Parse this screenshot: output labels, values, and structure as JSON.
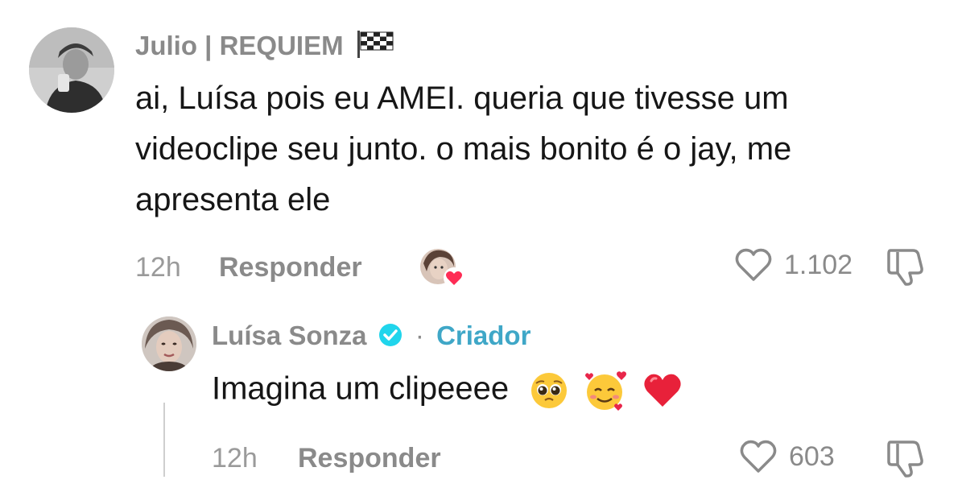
{
  "comments": [
    {
      "username": "Julio | REQUIEM",
      "username_suffix_icon": "checkered-flag-icon",
      "text_lines": [
        "ai, Luísa pois eu AMEI. queria que tivesse um",
        "videoclipe seu junto. o mais bonito é o jay, me",
        "apresenta ele"
      ],
      "time": "12h",
      "reply_label": "Responder",
      "liked_by_creator": true,
      "likes": "1.102"
    }
  ],
  "reply": {
    "username": "Luísa Sonza",
    "verified": true,
    "separator": "·",
    "badge": "Criador",
    "text": "Imagina um clipeeee",
    "emojis": [
      "pleading-face-emoji",
      "smiling-face-with-hearts-emoji",
      "red-heart-emoji"
    ],
    "time": "12h",
    "reply_label": "Responder",
    "likes": "603"
  },
  "colors": {
    "username": "#8a8a8a",
    "text": "#161616",
    "creator_badge": "#3fa7c7",
    "verified": "#20d5ec",
    "heart": "#fe2c55"
  }
}
